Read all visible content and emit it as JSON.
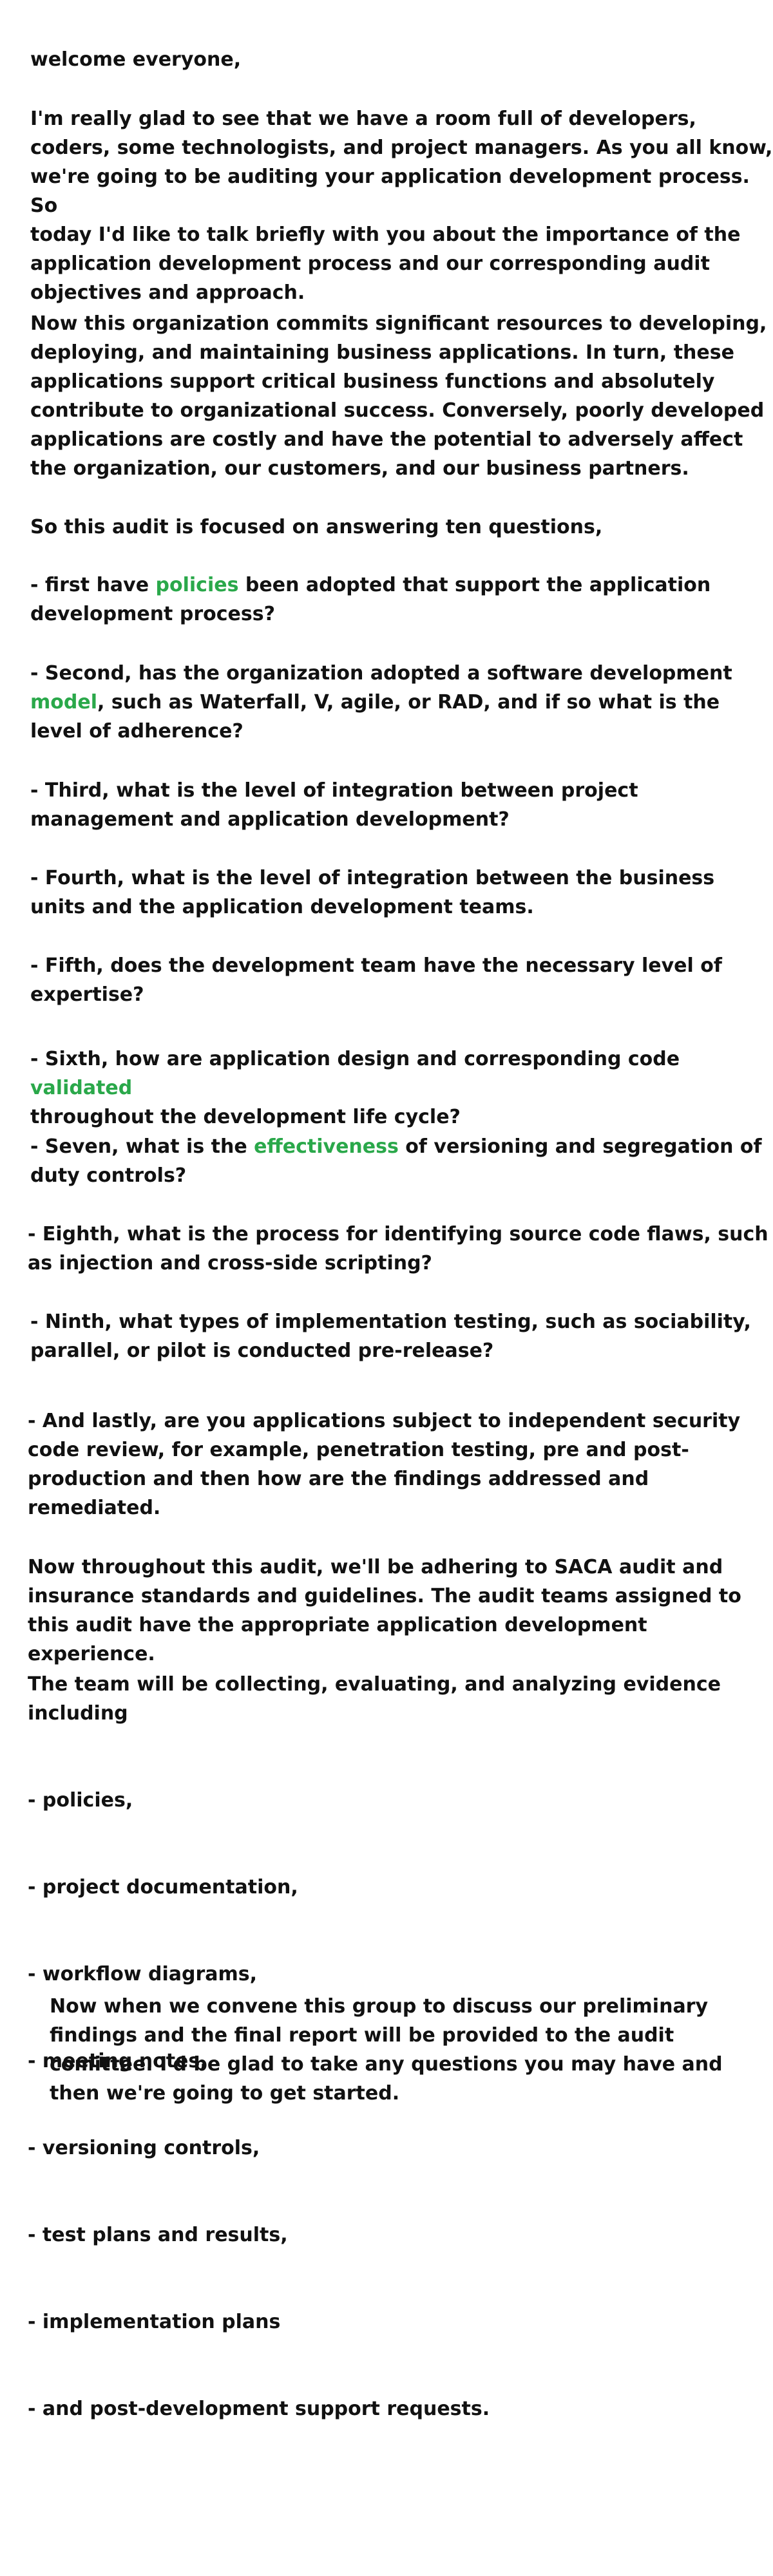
{
  "colors": {
    "text": "#111111",
    "highlight": "#2aa84a",
    "background": "#ffffff"
  },
  "greeting": "welcome everyone,",
  "intro": "I'm really glad to see that we have a room full of developers,\ncoders, some technologists, and project managers. As you all know,\nwe're going to be auditing your application development process. So\ntoday I'd like to talk briefly with you about the importance of the\napplication development process and our corresponding audit\nobjectives and approach.",
  "context": "Now this organization commits significant resources to developing,\ndeploying, and maintaining business applications. In turn, these\napplications support critical business functions and absolutely\ncontribute to organizational success. Conversely, poorly developed\napplications are costly and have the potential to adversely affect\nthe organization, our customers, and our business partners.",
  "questions_intro": "So this audit is focused on answering ten questions,",
  "questions": {
    "q1": {
      "before": "- first have ",
      "highlight": "policies",
      "after": " been adopted that support the application\ndevelopment process?"
    },
    "q2": {
      "before": "- Second, has the organization adopted a software development\n",
      "highlight": "model",
      "after": ", such as Waterfall, V, agile, or RAD, and if so what is the\nlevel of adherence?"
    },
    "q3": {
      "text": "- Third, what is the level of integration between project\nmanagement and application development?"
    },
    "q4": {
      "text": "- Fourth, what is the level of integration between the business\nunits and the application development teams."
    },
    "q5": {
      "text": "- Fifth, does the development team have the necessary level of\nexpertise?"
    },
    "q6": {
      "before": "- Sixth, how are application design and corresponding code ",
      "highlight": "validated",
      "after": "\nthroughout the development life cycle?"
    },
    "q7": {
      "before": "- Seven, what is the ",
      "highlight": "effectiveness",
      "after": " of versioning and segregation of\nduty controls?"
    },
    "q8": {
      "text": "- Eighth, what is the process for identifying source code flaws, such\nas injection and cross-side scripting?"
    },
    "q9": {
      "text": "- Ninth, what types of implementation testing, such as sociability,\nparallel, or pilot is conducted pre-release?"
    },
    "q10": {
      "text": "- And lastly, are you applications subject to independent security\ncode review, for example, penetration testing, pre and post-\nproduction and then how are the findings addressed and\nremediated."
    }
  },
  "standards": "Now throughout this audit, we'll be adhering to SACA audit and\ninsurance standards and guidelines. The audit teams assigned to\nthis audit have the appropriate application development experience.",
  "evidence": {
    "intro": "The team will be collecting, evaluating, and analyzing evidence\nincluding",
    "items": [
      "- policies,",
      "- project documentation,",
      "- workflow diagrams,",
      "- meeting notes,",
      "- versioning controls,",
      "- test plans and results,",
      "- implementation plans",
      "- and post-development support requests."
    ]
  },
  "closing": "Now when we convene this group to discuss our preliminary\nfindings and the final report will be provided to the audit\ncomittee. I'd be glad to take any questions you may have and\nthen we're going to get started."
}
